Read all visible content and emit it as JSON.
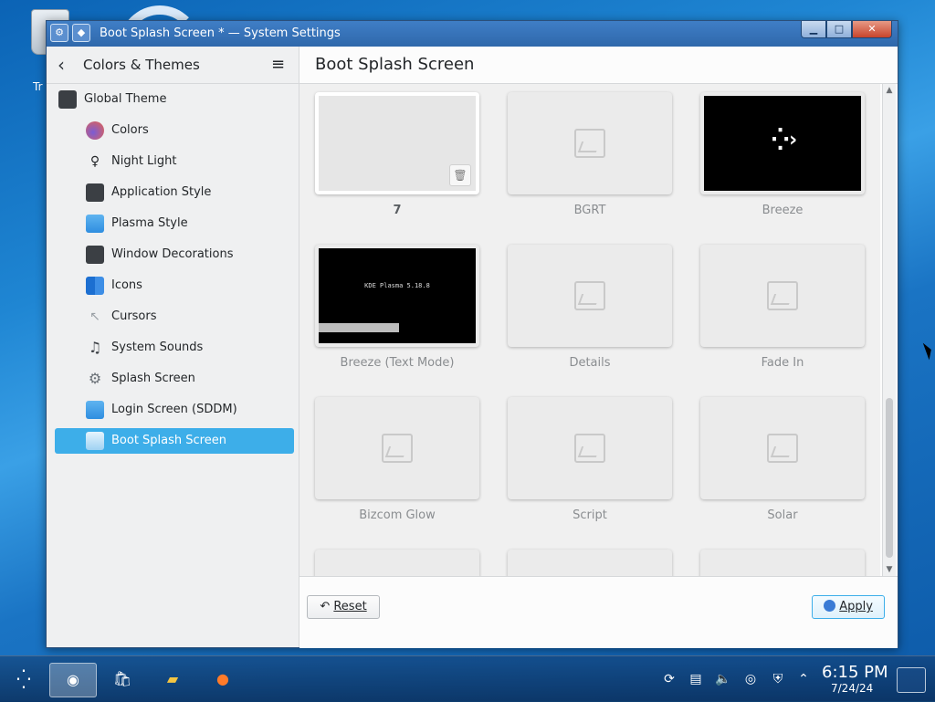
{
  "desktop": {
    "trash_label": "Tr",
    "trash_icon": "trash-icon"
  },
  "window": {
    "title": "Boot Splash Screen * — System Settings",
    "icon": "system-settings-icon",
    "buttons": {
      "minimize": "▁",
      "maximize": "□",
      "close": "✕"
    }
  },
  "sidebar": {
    "back_icon": "back-arrow-icon",
    "title": "Colors & Themes",
    "menu_icon": "hamburger-menu-icon",
    "items": [
      {
        "label": "Global Theme",
        "icon": "global-theme-icon",
        "color": "#3b3f44"
      },
      {
        "label": "Colors",
        "icon": "colors-icon",
        "color": "#e8634b"
      },
      {
        "label": "Night Light",
        "icon": "night-light-icon",
        "color": "#232629"
      },
      {
        "label": "Application Style",
        "icon": "application-style-icon",
        "color": "#3b3f44"
      },
      {
        "label": "Plasma Style",
        "icon": "plasma-style-icon",
        "color": "#2f8ee0"
      },
      {
        "label": "Window Decorations",
        "icon": "window-decorations-icon",
        "color": "#3b3f44"
      },
      {
        "label": "Icons",
        "icon": "icons-icon",
        "color": "#1c6fd1"
      },
      {
        "label": "Cursors",
        "icon": "cursors-icon",
        "color": "#c9ccd0"
      },
      {
        "label": "System Sounds",
        "icon": "system-sounds-icon",
        "color": "#3b3f44"
      },
      {
        "label": "Splash Screen",
        "icon": "splash-screen-icon",
        "color": "#6c7278"
      },
      {
        "label": "Login Screen (SDDM)",
        "icon": "login-screen-icon",
        "color": "#2f8ee0"
      },
      {
        "label": "Boot Splash Screen",
        "icon": "boot-splash-screen-icon",
        "color": "#2f8ee0",
        "active": true
      }
    ]
  },
  "main": {
    "title": "Boot Splash Screen",
    "themes": [
      {
        "label": "7",
        "preview": "blank",
        "selected": true
      },
      {
        "label": "BGRT",
        "preview": "placeholder"
      },
      {
        "label": "Breeze",
        "preview": "breeze"
      },
      {
        "label": "Breeze (Text Mode)",
        "preview": "text-mode",
        "preview_text": "KDE Plasma 5.18.8"
      },
      {
        "label": "Details",
        "preview": "placeholder"
      },
      {
        "label": "Fade In",
        "preview": "placeholder"
      },
      {
        "label": "Bizcom Glow",
        "preview": "placeholder"
      },
      {
        "label": "Script",
        "preview": "placeholder"
      },
      {
        "label": "Solar",
        "preview": "placeholder"
      }
    ],
    "delete_icon": "trash-icon",
    "image_placeholder_icon": "image-placeholder-icon",
    "footer": {
      "reset_icon": "undo-icon",
      "reset_label": "Reset",
      "apply_icon": "apply-icon",
      "apply_label": "Apply"
    }
  },
  "taskbar": {
    "start_icon": "kde-start-icon",
    "items": [
      {
        "icon": "system-settings-icon",
        "active": true
      },
      {
        "icon": "discover-icon"
      },
      {
        "icon": "file-manager-icon"
      },
      {
        "icon": "firefox-icon"
      }
    ],
    "tray": [
      "update-icon",
      "clipboard-icon",
      "volume-icon",
      "disc-icon",
      "security-icon",
      "expand-tray-icon"
    ],
    "time": "6:15 PM",
    "date": "7/24/24",
    "show_desktop_icon": "show-desktop-icon"
  },
  "colors": {
    "accent": "#3daee9",
    "titlebar": "#2f68ab"
  }
}
